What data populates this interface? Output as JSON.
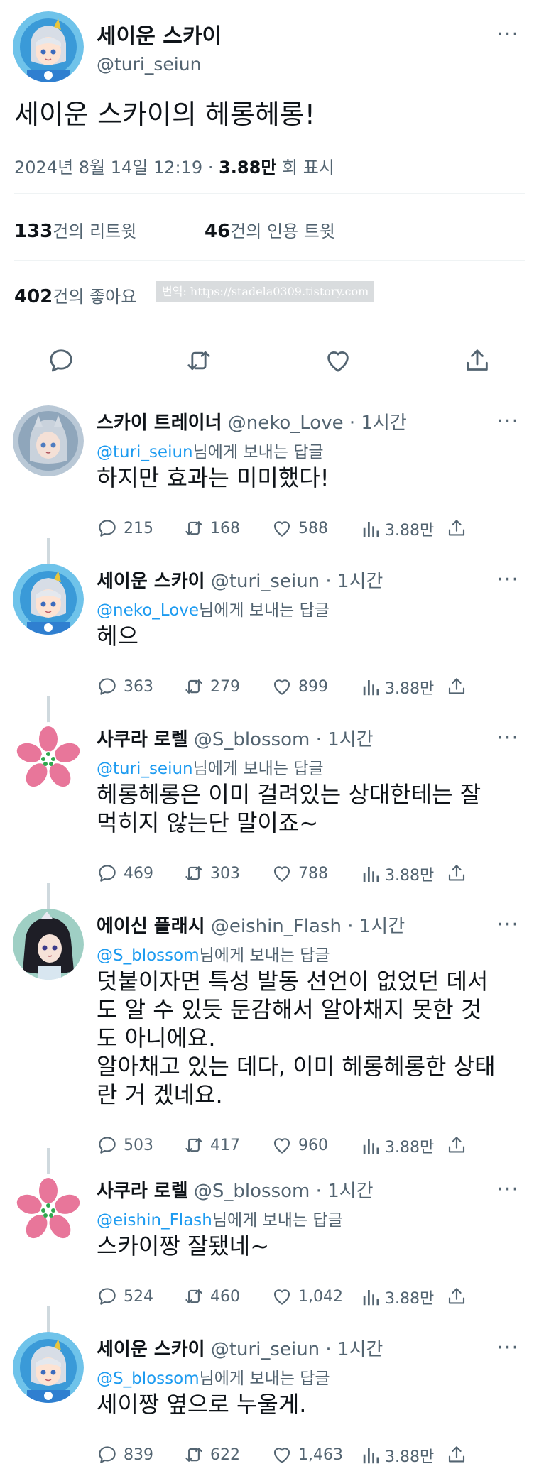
{
  "main_tweet": {
    "display_name": "세이운 스카이",
    "handle": "@turi_seiun",
    "text": "세이운 스카이의 헤롱헤롱!",
    "timestamp": "2024년 8월 14일  12:19",
    "dot": "·",
    "views": "3.88만",
    "views_suffix": "회 표시",
    "retweets_count": "133",
    "retweets_label": "건의 리트윗",
    "quotes_count": "46",
    "quotes_label": "건의 인용 트윗",
    "likes_count": "402",
    "likes_label": "건의 좋아요",
    "watermark": "번역: https://stadela0309.tistory.com",
    "more": "···"
  },
  "reply_to_suffix": "님에게 보내는 답글",
  "replies": [
    {
      "name": "스카이 트레이너",
      "handle": "@neko_Love",
      "dot": "·",
      "time": "1시간",
      "reply_to": "@turi_seiun",
      "text_lines": [
        "하지만 효과는 미미했다!"
      ],
      "replies": "215",
      "retweets": "168",
      "likes": "588",
      "views": "3.88만"
    },
    {
      "name": "세이운 스카이",
      "handle": "@turi_seiun",
      "dot": "·",
      "time": "1시간",
      "reply_to": "@neko_Love",
      "text_lines": [
        "헤으"
      ],
      "replies": "363",
      "retweets": "279",
      "likes": "899",
      "views": "3.88만"
    },
    {
      "name": "사쿠라 로렐",
      "handle": "@S_blossom",
      "dot": "·",
      "time": "1시간",
      "reply_to": "@turi_seiun",
      "text_lines": [
        "헤롱헤롱은 이미 걸려있는 상대한테는 잘",
        "먹히지 않는단 말이죠~"
      ],
      "replies": "469",
      "retweets": "303",
      "likes": "788",
      "views": "3.88만"
    },
    {
      "name": "에이신 플래시",
      "handle": "@eishin_Flash",
      "dot": "·",
      "time": "1시간",
      "reply_to": "@S_blossom",
      "text_lines": [
        "덧붙이자면 특성 발동 선언이 없었던 데서",
        "도 알 수 있듯 둔감해서 알아채지 못한 것",
        "도 아니에요.",
        "알아채고 있는 데다, 이미 헤롱헤롱한 상태",
        "란 거 겠네요."
      ],
      "replies": "503",
      "retweets": "417",
      "likes": "960",
      "views": "3.88만"
    },
    {
      "name": "사쿠라 로렐",
      "handle": "@S_blossom",
      "dot": "·",
      "time": "1시간",
      "reply_to": "@eishin_Flash",
      "text_lines": [
        "스카이짱 잘됐네~"
      ],
      "replies": "524",
      "retweets": "460",
      "likes": "1,042",
      "views": "3.88만"
    },
    {
      "name": "세이운 스카이",
      "handle": "@turi_seiun",
      "dot": "·",
      "time": "1시간",
      "reply_to": "@S_blossom",
      "text_lines": [
        "세이짱 옆으로 누울게."
      ],
      "replies": "839",
      "retweets": "622",
      "likes": "1,463",
      "views": "3.88만"
    }
  ],
  "icons": {
    "reply": "speech-bubble-icon",
    "retweet": "retweet-icon",
    "like": "heart-icon",
    "share": "share-icon",
    "views": "bar-chart-icon",
    "more": "more-dots-icon"
  },
  "colors": {
    "text": "#0f1419",
    "secondary": "#536471",
    "link": "#1d9bf0",
    "divider": "#eff3f4",
    "thread_line": "#cfd9de",
    "sakura": "#e8769a"
  }
}
